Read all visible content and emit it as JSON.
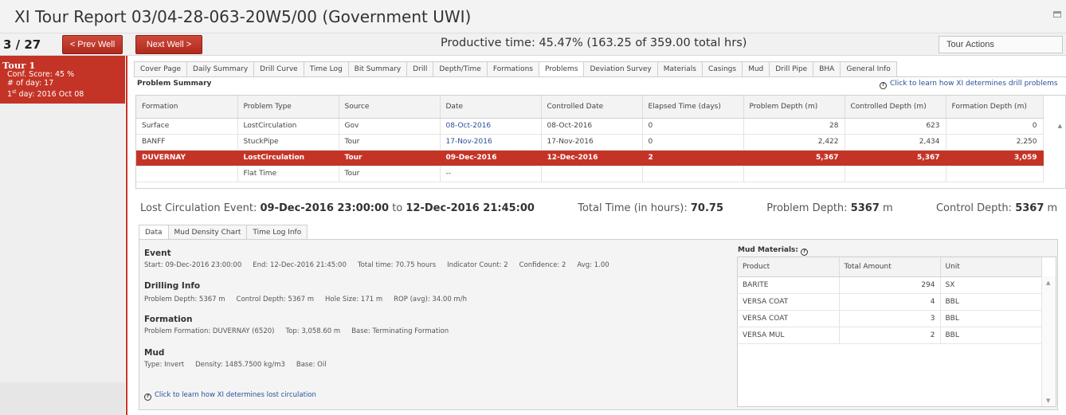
{
  "window": {
    "title": "XI Tour Report 03/04-28-063-20W5/00 (Government UWI)"
  },
  "topbar": {
    "counter": "3 / 27",
    "prev_well": "< Prev Well",
    "next_well": "Next Well >",
    "productive_time": "Productive time: 45.47% (163.25 of 359.00 total hrs)",
    "tour_actions": "Tour Actions"
  },
  "sidebar": {
    "tour_name": "Tour 1",
    "conf_score": "Conf. Score: 45 %",
    "num_day": "# of day: 17",
    "first_day_prefix": "1",
    "first_day_sup": "st",
    "first_day_rest": " day: 2016 Oct 08"
  },
  "tabs": [
    "Cover Page",
    "Daily Summary",
    "Drill Curve",
    "Time Log",
    "Bit Summary",
    "Drill",
    "Depth/Time",
    "Formations",
    "Problems",
    "Deviation Survey",
    "Materials",
    "Casings",
    "Mud",
    "Drill Pipe",
    "BHA",
    "General Info"
  ],
  "active_tab": "Problems",
  "problem_summary": {
    "title": "Problem Summary",
    "help_link": "Click to learn how XI determines drill problems",
    "columns": [
      "Formation",
      "Problem Type",
      "Source",
      "Date",
      "Controlled Date",
      "Elapsed Time (days)",
      "Problem Depth (m)",
      "Controlled Depth (m)",
      "Formation Depth (m)"
    ],
    "rows": [
      [
        "Surface",
        "LostCirculation",
        "Gov",
        "08-Oct-2016",
        "08-Oct-2016",
        "0",
        "28",
        "623",
        "0"
      ],
      [
        "BANFF",
        "StuckPipe",
        "Tour",
        "17-Nov-2016",
        "17-Nov-2016",
        "0",
        "2,422",
        "2,434",
        "2,250"
      ],
      [
        "DUVERNAY",
        "LostCirculation",
        "Tour",
        "09-Dec-2016",
        "12-Dec-2016",
        "2",
        "5,367",
        "5,367",
        "3,059"
      ],
      [
        "",
        "Flat Time",
        "Tour",
        "--",
        "",
        "",
        "",
        "",
        ""
      ]
    ]
  },
  "event_summary": {
    "label": "Lost Circulation Event: ",
    "start": "09-Dec-2016 23:00:00",
    "to": " to ",
    "end": "12-Dec-2016 21:45:00",
    "total_label": "Total Time (in hours): ",
    "total_value": "70.75",
    "pdepth_label": "Problem Depth: ",
    "pdepth_value": "5367",
    "pdepth_unit": " m",
    "cdepth_label": "Control Depth: ",
    "cdepth_value": "5367",
    "cdepth_unit": " m"
  },
  "lower_tabs": [
    "Data",
    "Mud Density Chart",
    "Time Log Info"
  ],
  "details": {
    "event_h": "Event",
    "event_items": [
      "Start: 09-Dec-2016 23:00:00",
      "End: 12-Dec-2016 21:45:00",
      "Total time: 70.75 hours",
      "Indicator Count: 2",
      "Confidence: 2",
      "Avg: 1.00"
    ],
    "drilling_h": "Drilling Info",
    "drilling_items": [
      "Problem Depth: 5367 m",
      "Control Depth: 5367 m",
      "Hole Size: 171 m",
      "ROP (avg): 34.00 m/h"
    ],
    "formation_h": "Formation",
    "formation_items": [
      "Problem Formation: DUVERNAY (6520)",
      "Top: 3,058.60 m",
      "Base: Terminating Formation"
    ],
    "mud_h": "Mud",
    "mud_items": [
      "Type: Invert",
      "Density: 1485.7500 kg/m3",
      "Base: Oil"
    ],
    "lc_link": "Click to learn how XI determines lost circulation"
  },
  "mud_materials": {
    "title": "Mud Materials:",
    "columns": [
      "Product",
      "Total Amount",
      "Unit"
    ],
    "rows": [
      [
        "BARITE",
        "294",
        "SX"
      ],
      [
        "VERSA COAT",
        "4",
        "BBL"
      ],
      [
        "VERSA COAT",
        "3",
        "BBL"
      ],
      [
        "VERSA MUL",
        "2",
        "BBL"
      ]
    ]
  },
  "icons": {
    "help": "question-circle-icon",
    "window": "restore-icon"
  },
  "colors": {
    "accent": "#c43426",
    "link": "#2a4f9b"
  }
}
